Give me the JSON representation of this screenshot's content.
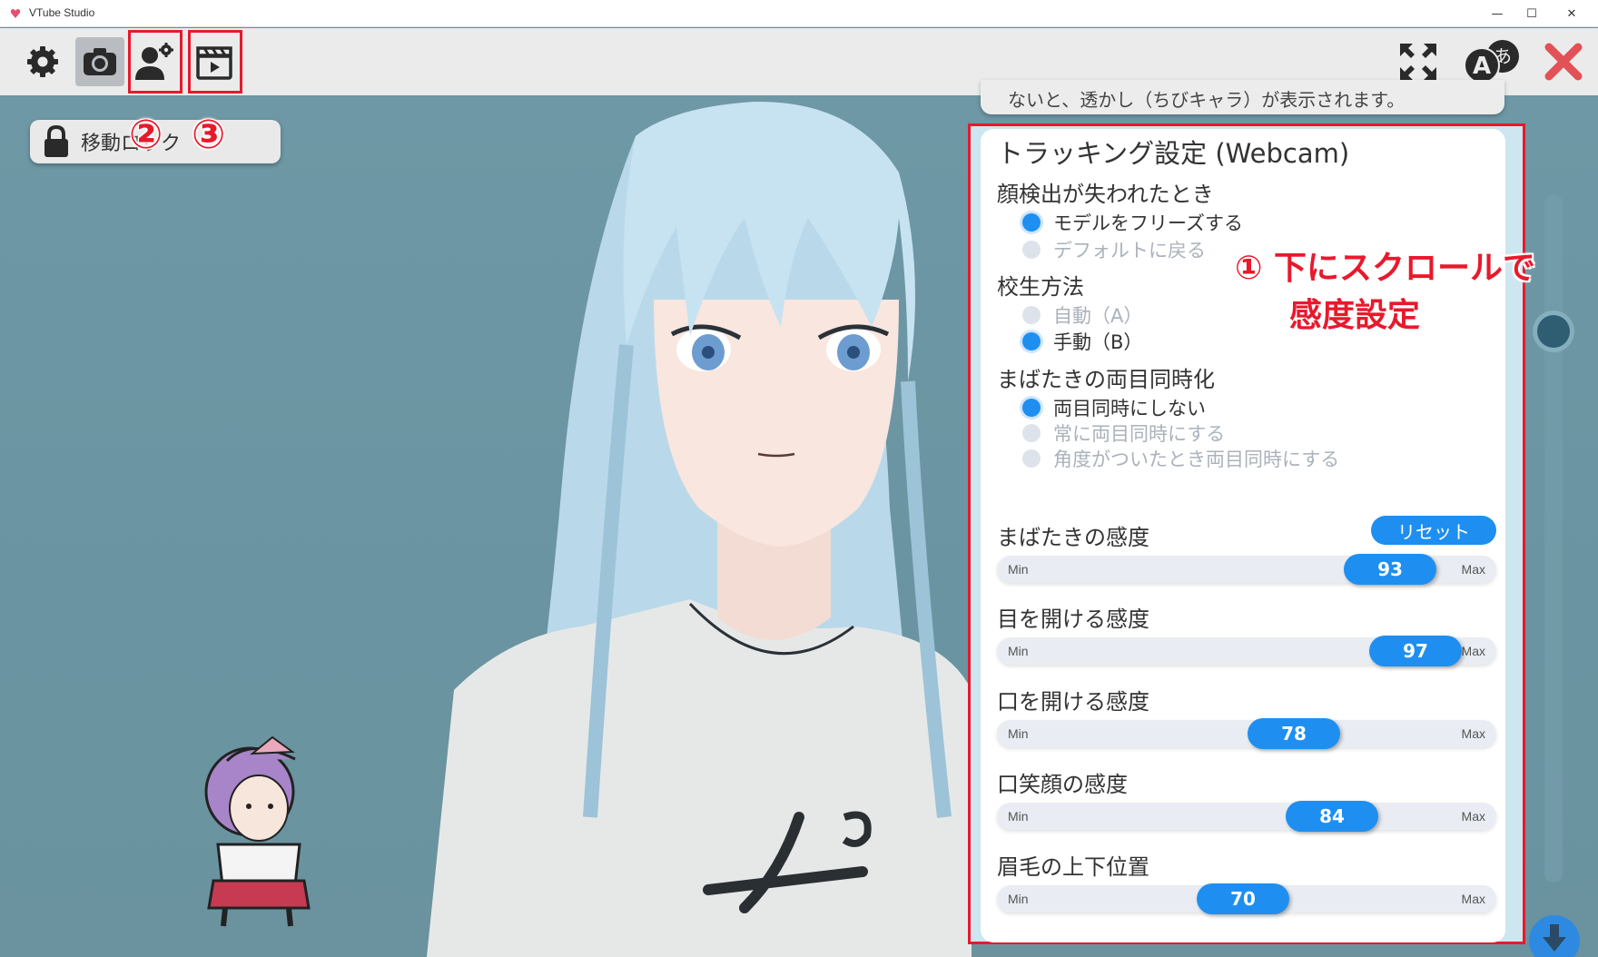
{
  "window": {
    "title": "VTube Studio",
    "min": "—",
    "max": "☐",
    "close": "✕"
  },
  "toolbar": {
    "highlights": [
      "②",
      "③"
    ],
    "icons": [
      "gear-icon",
      "camera-icon",
      "user-settings-icon",
      "clapperboard-icon",
      "fullscreen-icon",
      "language-icon",
      "close-icon"
    ]
  },
  "move_lock": {
    "label": "移動ロック"
  },
  "tooltip": {
    "text": "ないと、透かし（ちびキャラ）が表示されます。"
  },
  "annotation": {
    "circle": "①",
    "line1": "下にスクロールで",
    "line2": "感度設定"
  },
  "panel": {
    "title": "トラッキング設定 (Webcam)",
    "face_lost": {
      "label": "顔検出が失われたとき",
      "options": [
        {
          "label": "モデルをフリーズする",
          "selected": true
        },
        {
          "label": "デフォルトに戻る",
          "selected": false
        }
      ]
    },
    "calibration": {
      "label": "校生方法",
      "options": [
        {
          "label": "自動（A）",
          "selected": false
        },
        {
          "label": "手動（B）",
          "selected": true
        }
      ]
    },
    "blink_sync": {
      "label": "まばたきの両目同時化",
      "options": [
        {
          "label": "両目同時にしない",
          "selected": true
        },
        {
          "label": "常に両目同時にする",
          "selected": false
        },
        {
          "label": "角度がついたとき両目同時にする",
          "selected": false
        }
      ]
    },
    "reset_label": "リセット",
    "sliders": [
      {
        "label": "まばたきの感度",
        "value": "93",
        "level": 0.93,
        "min": "Min",
        "max": "Max"
      },
      {
        "label": "目を開ける感度",
        "value": "97",
        "level": 0.97,
        "min": "Min",
        "max": "Max"
      },
      {
        "label": "口を開ける感度",
        "value": "78",
        "level": 0.78,
        "min": "Min",
        "max": "Max"
      },
      {
        "label": "口笑顔の感度",
        "value": "84",
        "level": 0.84,
        "min": "Min",
        "max": "Max"
      },
      {
        "label": "眉毛の上下位置",
        "value": "70",
        "level": 0.7,
        "min": "Min",
        "max": "Max"
      }
    ]
  },
  "colors": {
    "accent": "#1e8ff0",
    "annotation": "#e8192c",
    "background": "#6b96a3"
  }
}
